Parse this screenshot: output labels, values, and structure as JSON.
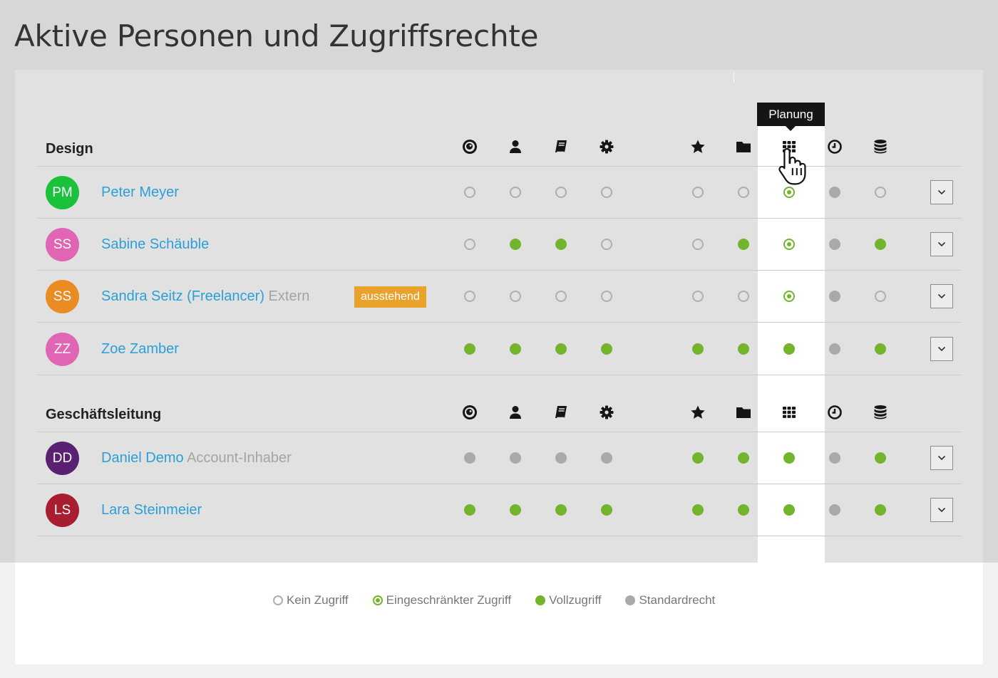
{
  "page_title": "Aktive Personen und Zugriffsrechte",
  "tooltip": "Planung",
  "column_icons": [
    "target-icon",
    "user-icon",
    "book-icon",
    "gear-icon",
    "star-icon",
    "folder-icon",
    "grid-icon",
    "clock-icon",
    "database-icon"
  ],
  "groups": [
    {
      "name": "Design",
      "members": [
        {
          "initials": "PM",
          "avatar_color": "#19c23a",
          "name": "Peter Meyer",
          "role": "",
          "badge": "",
          "access": [
            "none",
            "none",
            "none",
            "none",
            "none",
            "none",
            "limited",
            "std",
            "none"
          ]
        },
        {
          "initials": "SS",
          "avatar_color": "#e066b5",
          "name": "Sabine Schäuble",
          "role": "",
          "badge": "",
          "access": [
            "none",
            "full",
            "full",
            "none",
            "none",
            "full",
            "limited",
            "std",
            "full"
          ]
        },
        {
          "initials": "SS",
          "avatar_color": "#ea8b24",
          "name": "Sandra Seitz (Freelancer)",
          "role": "Extern",
          "badge": "ausstehend",
          "access": [
            "none",
            "none",
            "none",
            "none",
            "none",
            "none",
            "limited",
            "std",
            "none"
          ]
        },
        {
          "initials": "ZZ",
          "avatar_color": "#e066b5",
          "name": "Zoe Zamber",
          "role": "",
          "badge": "",
          "access": [
            "full",
            "full",
            "full",
            "full",
            "full",
            "full",
            "full",
            "std",
            "full"
          ]
        }
      ]
    },
    {
      "name": "Geschäftsleitung",
      "members": [
        {
          "initials": "DD",
          "avatar_color": "#5a2173",
          "name": "Daniel Demo",
          "role": "Account-Inhaber",
          "badge": "",
          "access": [
            "std",
            "std",
            "std",
            "std",
            "full",
            "full",
            "full",
            "std",
            "full"
          ]
        },
        {
          "initials": "LS",
          "avatar_color": "#a81d30",
          "name": "Lara Steinmeier",
          "role": "",
          "badge": "",
          "access": [
            "full",
            "full",
            "full",
            "full",
            "full",
            "full",
            "full",
            "std",
            "full"
          ]
        }
      ]
    }
  ],
  "legend": [
    {
      "key": "none",
      "label": "Kein Zugriff"
    },
    {
      "key": "limited",
      "label": "Eingeschränkter Zugriff"
    },
    {
      "key": "full",
      "label": "Vollzugriff"
    },
    {
      "key": "std",
      "label": "Standardrecht"
    }
  ],
  "colors": {
    "full": "#72b52c",
    "standard": "#a9a9a9",
    "link": "#2a9fd8",
    "badge": "#e9a32d"
  }
}
